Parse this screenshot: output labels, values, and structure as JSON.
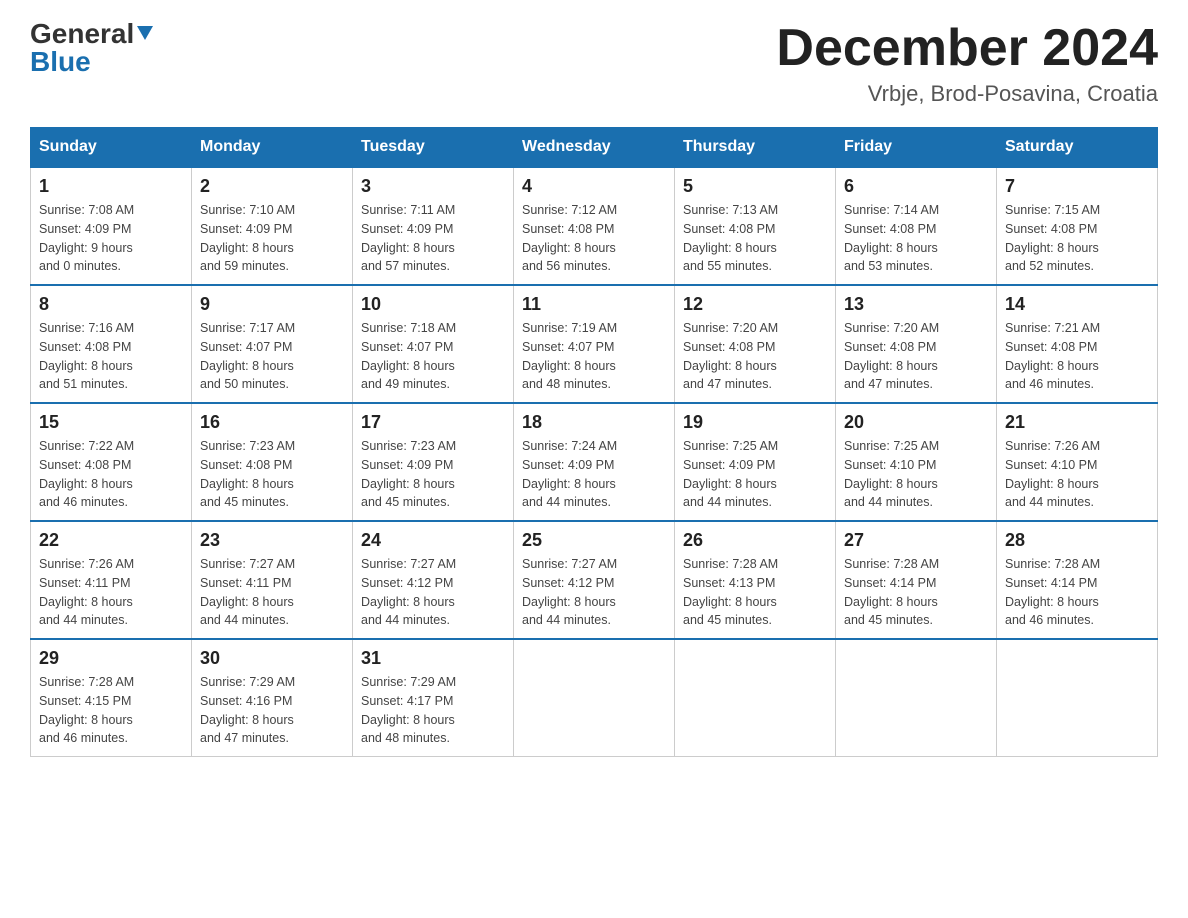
{
  "logo": {
    "general": "General",
    "blue": "Blue"
  },
  "title": "December 2024",
  "subtitle": "Vrbje, Brod-Posavina, Croatia",
  "days_of_week": [
    "Sunday",
    "Monday",
    "Tuesday",
    "Wednesday",
    "Thursday",
    "Friday",
    "Saturday"
  ],
  "weeks": [
    [
      {
        "day": "1",
        "sunrise": "Sunrise: 7:08 AM",
        "sunset": "Sunset: 4:09 PM",
        "daylight": "Daylight: 9 hours",
        "daylight2": "and 0 minutes."
      },
      {
        "day": "2",
        "sunrise": "Sunrise: 7:10 AM",
        "sunset": "Sunset: 4:09 PM",
        "daylight": "Daylight: 8 hours",
        "daylight2": "and 59 minutes."
      },
      {
        "day": "3",
        "sunrise": "Sunrise: 7:11 AM",
        "sunset": "Sunset: 4:09 PM",
        "daylight": "Daylight: 8 hours",
        "daylight2": "and 57 minutes."
      },
      {
        "day": "4",
        "sunrise": "Sunrise: 7:12 AM",
        "sunset": "Sunset: 4:08 PM",
        "daylight": "Daylight: 8 hours",
        "daylight2": "and 56 minutes."
      },
      {
        "day": "5",
        "sunrise": "Sunrise: 7:13 AM",
        "sunset": "Sunset: 4:08 PM",
        "daylight": "Daylight: 8 hours",
        "daylight2": "and 55 minutes."
      },
      {
        "day": "6",
        "sunrise": "Sunrise: 7:14 AM",
        "sunset": "Sunset: 4:08 PM",
        "daylight": "Daylight: 8 hours",
        "daylight2": "and 53 minutes."
      },
      {
        "day": "7",
        "sunrise": "Sunrise: 7:15 AM",
        "sunset": "Sunset: 4:08 PM",
        "daylight": "Daylight: 8 hours",
        "daylight2": "and 52 minutes."
      }
    ],
    [
      {
        "day": "8",
        "sunrise": "Sunrise: 7:16 AM",
        "sunset": "Sunset: 4:08 PM",
        "daylight": "Daylight: 8 hours",
        "daylight2": "and 51 minutes."
      },
      {
        "day": "9",
        "sunrise": "Sunrise: 7:17 AM",
        "sunset": "Sunset: 4:07 PM",
        "daylight": "Daylight: 8 hours",
        "daylight2": "and 50 minutes."
      },
      {
        "day": "10",
        "sunrise": "Sunrise: 7:18 AM",
        "sunset": "Sunset: 4:07 PM",
        "daylight": "Daylight: 8 hours",
        "daylight2": "and 49 minutes."
      },
      {
        "day": "11",
        "sunrise": "Sunrise: 7:19 AM",
        "sunset": "Sunset: 4:07 PM",
        "daylight": "Daylight: 8 hours",
        "daylight2": "and 48 minutes."
      },
      {
        "day": "12",
        "sunrise": "Sunrise: 7:20 AM",
        "sunset": "Sunset: 4:08 PM",
        "daylight": "Daylight: 8 hours",
        "daylight2": "and 47 minutes."
      },
      {
        "day": "13",
        "sunrise": "Sunrise: 7:20 AM",
        "sunset": "Sunset: 4:08 PM",
        "daylight": "Daylight: 8 hours",
        "daylight2": "and 47 minutes."
      },
      {
        "day": "14",
        "sunrise": "Sunrise: 7:21 AM",
        "sunset": "Sunset: 4:08 PM",
        "daylight": "Daylight: 8 hours",
        "daylight2": "and 46 minutes."
      }
    ],
    [
      {
        "day": "15",
        "sunrise": "Sunrise: 7:22 AM",
        "sunset": "Sunset: 4:08 PM",
        "daylight": "Daylight: 8 hours",
        "daylight2": "and 46 minutes."
      },
      {
        "day": "16",
        "sunrise": "Sunrise: 7:23 AM",
        "sunset": "Sunset: 4:08 PM",
        "daylight": "Daylight: 8 hours",
        "daylight2": "and 45 minutes."
      },
      {
        "day": "17",
        "sunrise": "Sunrise: 7:23 AM",
        "sunset": "Sunset: 4:09 PM",
        "daylight": "Daylight: 8 hours",
        "daylight2": "and 45 minutes."
      },
      {
        "day": "18",
        "sunrise": "Sunrise: 7:24 AM",
        "sunset": "Sunset: 4:09 PM",
        "daylight": "Daylight: 8 hours",
        "daylight2": "and 44 minutes."
      },
      {
        "day": "19",
        "sunrise": "Sunrise: 7:25 AM",
        "sunset": "Sunset: 4:09 PM",
        "daylight": "Daylight: 8 hours",
        "daylight2": "and 44 minutes."
      },
      {
        "day": "20",
        "sunrise": "Sunrise: 7:25 AM",
        "sunset": "Sunset: 4:10 PM",
        "daylight": "Daylight: 8 hours",
        "daylight2": "and 44 minutes."
      },
      {
        "day": "21",
        "sunrise": "Sunrise: 7:26 AM",
        "sunset": "Sunset: 4:10 PM",
        "daylight": "Daylight: 8 hours",
        "daylight2": "and 44 minutes."
      }
    ],
    [
      {
        "day": "22",
        "sunrise": "Sunrise: 7:26 AM",
        "sunset": "Sunset: 4:11 PM",
        "daylight": "Daylight: 8 hours",
        "daylight2": "and 44 minutes."
      },
      {
        "day": "23",
        "sunrise": "Sunrise: 7:27 AM",
        "sunset": "Sunset: 4:11 PM",
        "daylight": "Daylight: 8 hours",
        "daylight2": "and 44 minutes."
      },
      {
        "day": "24",
        "sunrise": "Sunrise: 7:27 AM",
        "sunset": "Sunset: 4:12 PM",
        "daylight": "Daylight: 8 hours",
        "daylight2": "and 44 minutes."
      },
      {
        "day": "25",
        "sunrise": "Sunrise: 7:27 AM",
        "sunset": "Sunset: 4:12 PM",
        "daylight": "Daylight: 8 hours",
        "daylight2": "and 44 minutes."
      },
      {
        "day": "26",
        "sunrise": "Sunrise: 7:28 AM",
        "sunset": "Sunset: 4:13 PM",
        "daylight": "Daylight: 8 hours",
        "daylight2": "and 45 minutes."
      },
      {
        "day": "27",
        "sunrise": "Sunrise: 7:28 AM",
        "sunset": "Sunset: 4:14 PM",
        "daylight": "Daylight: 8 hours",
        "daylight2": "and 45 minutes."
      },
      {
        "day": "28",
        "sunrise": "Sunrise: 7:28 AM",
        "sunset": "Sunset: 4:14 PM",
        "daylight": "Daylight: 8 hours",
        "daylight2": "and 46 minutes."
      }
    ],
    [
      {
        "day": "29",
        "sunrise": "Sunrise: 7:28 AM",
        "sunset": "Sunset: 4:15 PM",
        "daylight": "Daylight: 8 hours",
        "daylight2": "and 46 minutes."
      },
      {
        "day": "30",
        "sunrise": "Sunrise: 7:29 AM",
        "sunset": "Sunset: 4:16 PM",
        "daylight": "Daylight: 8 hours",
        "daylight2": "and 47 minutes."
      },
      {
        "day": "31",
        "sunrise": "Sunrise: 7:29 AM",
        "sunset": "Sunset: 4:17 PM",
        "daylight": "Daylight: 8 hours",
        "daylight2": "and 48 minutes."
      },
      null,
      null,
      null,
      null
    ]
  ]
}
